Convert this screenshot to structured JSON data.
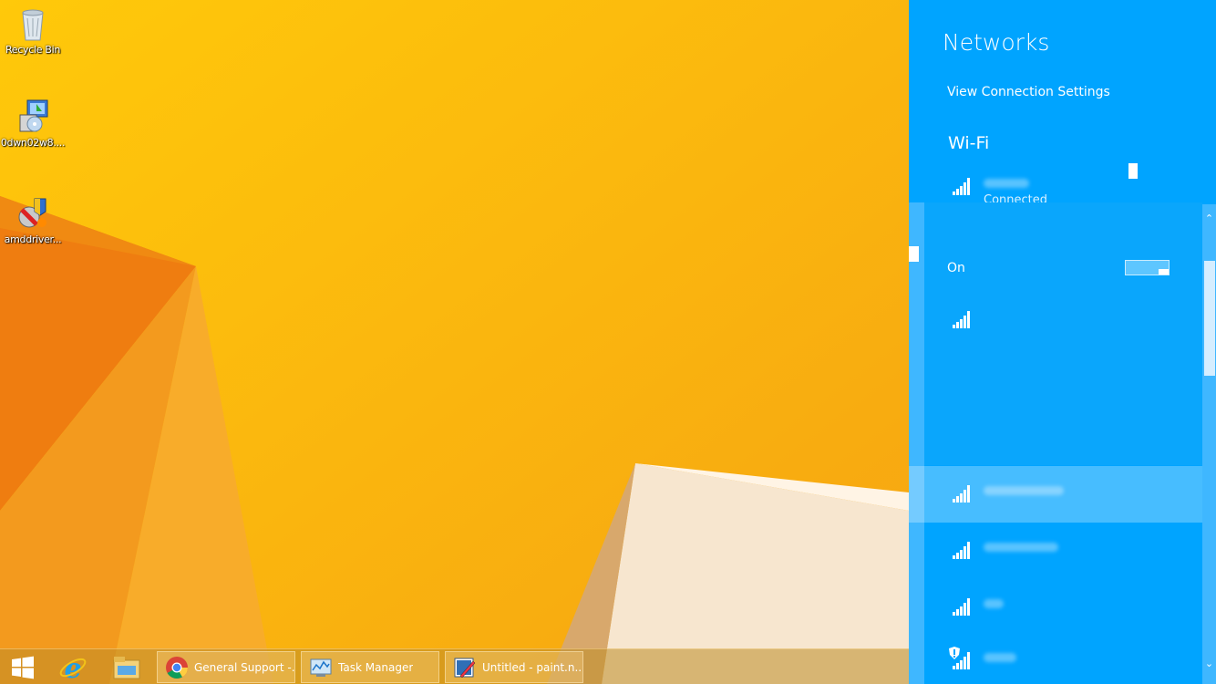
{
  "desktop": {
    "icons": [
      {
        "label": "Recycle Bin",
        "icon": "recycle-bin-icon"
      },
      {
        "label": "0dwn02w8....",
        "icon": "installer-icon"
      },
      {
        "label": "amddriver...",
        "icon": "amd-driver-icon"
      }
    ]
  },
  "taskbar": {
    "pinned": [
      "windows-start-icon",
      "internet-explorer-icon",
      "file-explorer-icon"
    ],
    "tasks": [
      {
        "label": "General Support -...",
        "icon": "chrome-icon"
      },
      {
        "label": "Task Manager",
        "icon": "task-manager-icon"
      },
      {
        "label": "Untitled - paint.n...",
        "icon": "paint-net-icon"
      }
    ]
  },
  "networks": {
    "title": "Networks",
    "view_settings": "View Connection Settings",
    "wifi_heading": "Wi-Fi",
    "connected_status": "Connected",
    "toggle_label": "On",
    "colors": {
      "charm_bg": "#00a4ff",
      "desktop_bg": "#f9b20e"
    }
  }
}
